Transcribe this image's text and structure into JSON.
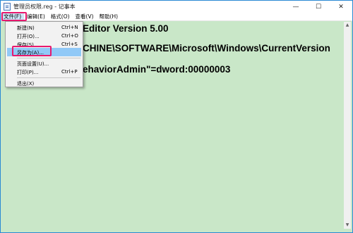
{
  "window": {
    "title": "管理员权限.reg - 记事本",
    "minimize_glyph": "—",
    "maximize_glyph": "☐",
    "close_glyph": "✕"
  },
  "menubar": {
    "items": [
      {
        "label": "文件(F)"
      },
      {
        "label": "编辑(E)"
      },
      {
        "label": "格式(O)"
      },
      {
        "label": "查看(V)"
      },
      {
        "label": "帮助(H)"
      }
    ]
  },
  "file_menu": {
    "items": [
      {
        "label": "新建(N)",
        "shortcut": "Ctrl+N"
      },
      {
        "label": "打开(O)...",
        "shortcut": "Ctrl+O"
      },
      {
        "label": "保存(S)",
        "shortcut": "Ctrl+S"
      },
      {
        "label": "另存为(A)...",
        "shortcut": ""
      },
      {
        "label": "页面设置(U)...",
        "shortcut": ""
      },
      {
        "label": "打印(P)...",
        "shortcut": "Ctrl+P"
      },
      {
        "label": "退出(X)",
        "shortcut": ""
      }
    ],
    "hovered_item": "另存为(A)..."
  },
  "editor": {
    "lines": [
      "Editor Version 5.00",
      "CHINE\\SOFTWARE\\Microsoft\\Windows\\CurrentVersion",
      "ehaviorAdmin\"=dword:00000003"
    ]
  },
  "colors": {
    "editor_background": "#c9e7c8",
    "highlight_border": "#e8196e",
    "menu_hover": "#91c9f7",
    "window_border": "#2a8ad4"
  }
}
